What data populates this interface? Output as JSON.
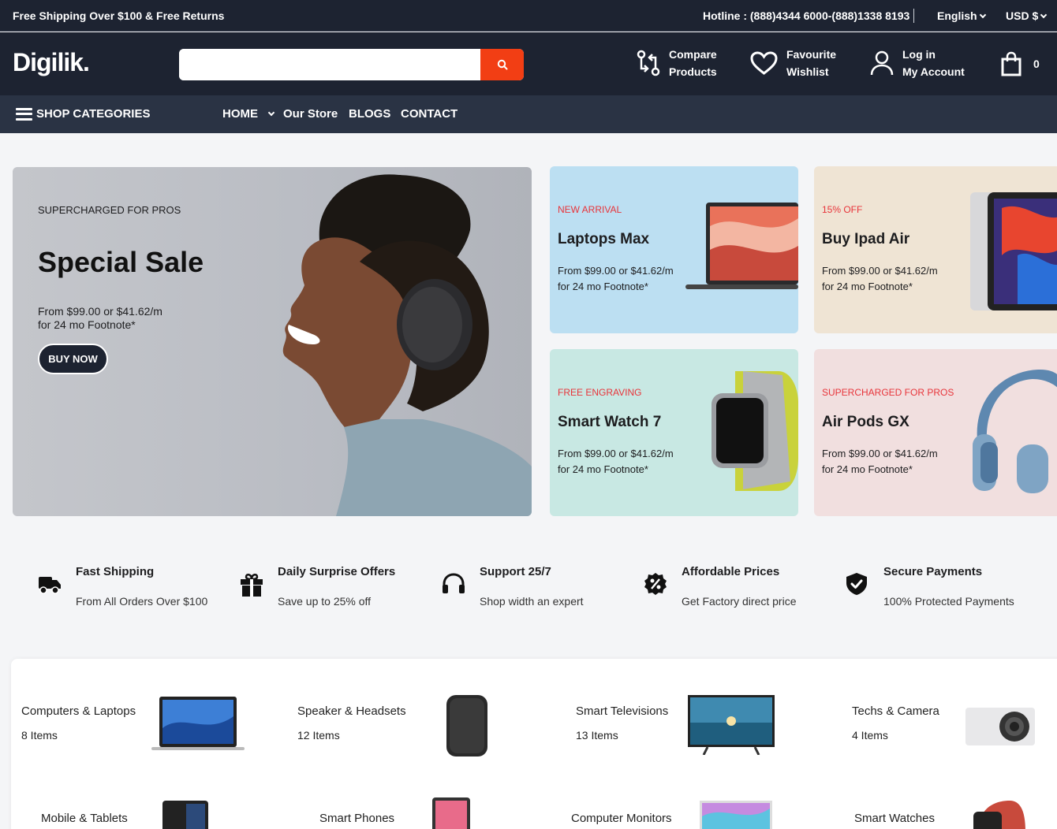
{
  "topbar": {
    "promo": "Free Shipping Over $100 & Free Returns",
    "hotline": "Hotline : (888)4344 6000-(888)1338 8193",
    "language": "English",
    "currency": "USD $"
  },
  "header": {
    "logo": "Digilik.",
    "search_placeholder": "",
    "compare": [
      "Compare",
      "Products"
    ],
    "wishlist": [
      "Favourite",
      "Wishlist"
    ],
    "account": [
      "Log in",
      "My Account"
    ],
    "cart_count": "0"
  },
  "nav": {
    "categories_label": "SHOP CATEGORIES",
    "items": [
      "HOME",
      "Our Store",
      "BLOGS",
      "CONTACT"
    ]
  },
  "hero": {
    "eyebrow": "SUPERCHARGED FOR PROS",
    "title": "Special Sale",
    "price_line1": "From $99.00 or $41.62/m",
    "price_line2": "for 24 mo Footnote*",
    "button": "BUY NOW"
  },
  "promos": [
    {
      "eyebrow": "NEW ARRIVAL",
      "name": "Laptops Max",
      "line1": "From $99.00 or $41.62/m",
      "line2": "for 24 mo Footnote*",
      "bg": "#bcdff2"
    },
    {
      "eyebrow": "15% OFF",
      "name": "Buy Ipad Air",
      "line1": "From $99.00 or $41.62/m",
      "line2": "for 24 mo Footnote*",
      "bg": "#efe4d4"
    },
    {
      "eyebrow": "FREE ENGRAVING",
      "name": "Smart Watch 7",
      "line1": "From $99.00 or $41.62/m",
      "line2": "for 24 mo Footnote*",
      "bg": "#c8e8e3"
    },
    {
      "eyebrow": "SUPERCHARGED FOR PROS",
      "name": "Air Pods GX",
      "line1": "From $99.00 or $41.62/m",
      "line2": "for 24 mo Footnote*",
      "bg": "#f1dfdf"
    }
  ],
  "features": [
    {
      "title": "Fast Shipping",
      "desc": "From All Orders Over $100",
      "icon": "truck-icon"
    },
    {
      "title": "Daily Surprise Offers",
      "desc": "Save up to 25% off",
      "icon": "gift-icon"
    },
    {
      "title": "Support 25/7",
      "desc": "Shop width an expert",
      "icon": "headphones-icon"
    },
    {
      "title": "Affordable Prices",
      "desc": "Get Factory direct price",
      "icon": "discount-badge-icon"
    },
    {
      "title": "Secure Payments",
      "desc": "100% Protected Payments",
      "icon": "shield-check-icon"
    }
  ],
  "categories": [
    {
      "name": "Computers & Laptops",
      "count": "8 Items"
    },
    {
      "name": "Speaker & Headsets",
      "count": "12 Items"
    },
    {
      "name": "Smart Televisions",
      "count": "13 Items"
    },
    {
      "name": "Techs & Camera",
      "count": "4 Items"
    },
    {
      "name": "Mobile & Tablets",
      "count": ""
    },
    {
      "name": "Smart Phones",
      "count": ""
    },
    {
      "name": "Computer Monitors",
      "count": ""
    },
    {
      "name": "Smart Watches",
      "count": ""
    }
  ],
  "colors": {
    "dark": "#1d2331",
    "nav": "#2a3344",
    "accent": "#f23e14",
    "eyebrow_red": "#e8343a"
  }
}
